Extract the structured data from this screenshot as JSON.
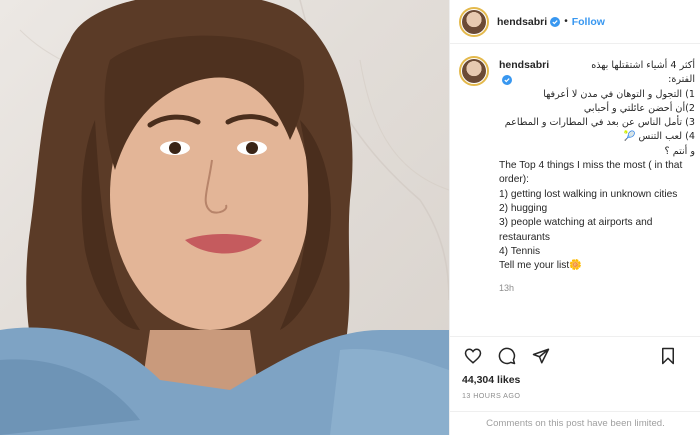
{
  "post": {
    "username": "hendsabri",
    "follow_label": "Follow",
    "dot": "•",
    "caption_lines_ar": [
      "أكثر 4 أشياء اشتقتلها بهذه الفترة:",
      "1) التجول و التوهان في مدن لا أعرفها",
      "2)أن أحضن عائلتي و أحبابي",
      "3) تأمل الناس عن بعد في المطارات و المطاعم",
      "4) لعب التنس 🎾",
      "و أنتم ؟"
    ],
    "caption_lines_en": [
      "The Top 4 things I miss the most ( in that order):",
      "1) getting lost walking in unknown cities",
      "2) hugging",
      "3) people watching at airports and restaurants",
      "4) Tennis",
      "Tell me your list🌼"
    ],
    "caption_time": "13h",
    "likes": "44,304 likes",
    "time_ago": "13 HOURS AGO",
    "comments_limited": "Comments on this post have been limited."
  },
  "icons": {
    "heart": "heart-icon",
    "comment": "comment-icon",
    "share": "share-icon",
    "bookmark": "bookmark-icon",
    "verified": "verified-badge-icon"
  },
  "colors": {
    "link": "#3897f0",
    "verified": "#3897f0",
    "muted": "#8e8e8e"
  }
}
